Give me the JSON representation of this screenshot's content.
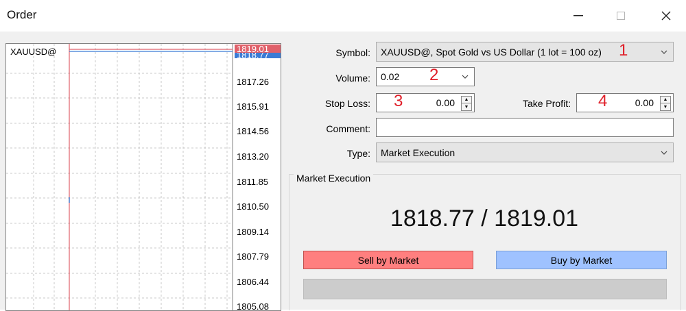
{
  "window": {
    "title": "Order",
    "minimize_icon": "minimize-icon",
    "maximize_icon": "maximize-icon",
    "close_icon": "close-icon"
  },
  "chart": {
    "symbol": "XAUUSD@",
    "axis_prices": [
      "1817.26",
      "1815.91",
      "1814.56",
      "1813.20",
      "1811.85",
      "1810.50",
      "1809.14",
      "1807.79",
      "1806.44",
      "1805.08"
    ],
    "ask_tag": "1819.01",
    "bid_tag": "1818.77"
  },
  "form": {
    "symbol_label": "Symbol:",
    "symbol_value": "XAUUSD@, Spot Gold vs US Dollar (1 lot = 100 oz)",
    "volume_label": "Volume:",
    "volume_value": "0.02",
    "stop_loss_label": "Stop Loss:",
    "stop_loss_value": "0.00",
    "take_profit_label": "Take Profit:",
    "take_profit_value": "0.00",
    "comment_label": "Comment:",
    "comment_value": "",
    "type_label": "Type:",
    "type_value": "Market Execution"
  },
  "annotations": [
    "1",
    "2",
    "3",
    "4"
  ],
  "market": {
    "group_title": "Market Execution",
    "quote": "1818.77 / 1819.01",
    "sell_label": "Sell by Market",
    "buy_label": "Buy by Market",
    "sell_color": "#ff7f7f",
    "buy_color": "#9fc2ff"
  }
}
